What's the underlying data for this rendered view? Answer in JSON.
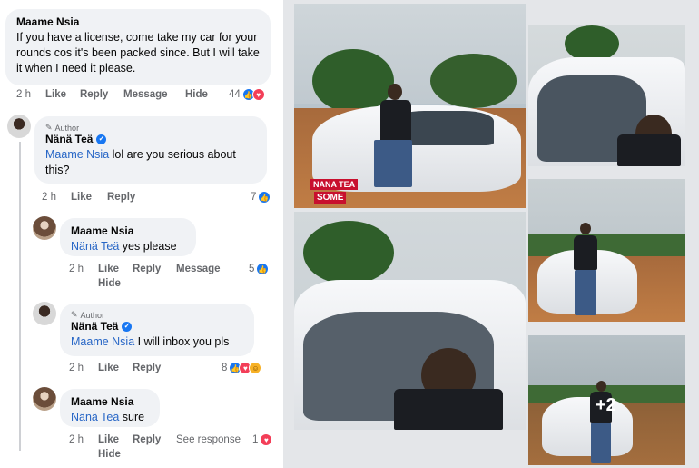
{
  "comments": [
    {
      "name": "Maame Nsia",
      "text": "If you have a license, come take my car for your rounds cos it's been packed since. But I will take it when I need it please.",
      "time": "2 h",
      "actions": [
        "Like",
        "Reply",
        "Message",
        "Hide"
      ],
      "reaction_count": "44"
    },
    {
      "author_tag": "Author",
      "name": "Nänä Teä",
      "mention": "Maame Nsia",
      "text": " lol are you serious about this?",
      "time": "2 h",
      "actions": [
        "Like",
        "Reply"
      ],
      "reaction_count": "7"
    },
    {
      "name": "Maame Nsia",
      "mention": "Nänä Teä",
      "text": " yes please",
      "time": "2 h",
      "actions": [
        "Like",
        "Reply",
        "Message",
        "Hide"
      ],
      "reaction_count": "5"
    },
    {
      "author_tag": "Author",
      "name": "Nänä Teä",
      "mention": "Maame Nsia",
      "text": " I will inbox you pls",
      "time": "2 h",
      "actions": [
        "Like",
        "Reply"
      ],
      "reaction_count": "8"
    },
    {
      "name": "Maame Nsia",
      "mention": "Nänä Teä",
      "text": " sure",
      "time": "2 h",
      "actions": [
        "Like",
        "Reply",
        "See response",
        "Hide"
      ],
      "reaction_count": "1"
    }
  ],
  "photos": {
    "more_count": "+2",
    "watermark": "NANA TEA",
    "watermark_sub": "SOME"
  },
  "colors": {
    "like": "#1877f2",
    "love": "#f33e58",
    "mention": "#2766c6",
    "bubble": "#f0f2f5"
  }
}
